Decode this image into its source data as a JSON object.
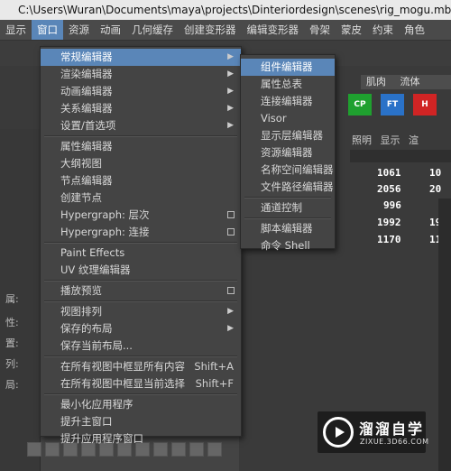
{
  "title": "C:\\Users\\Wuran\\Documents\\maya\\projects\\Dinteriordesign\\scenes\\rig_mogu.mb -",
  "menubar": [
    "显示",
    "窗口",
    "资源",
    "动画",
    "几何缓存",
    "创建变形器",
    "编辑变形器",
    "骨架",
    "蒙皮",
    "约束",
    "角色"
  ],
  "menubar_active": 1,
  "tabs_right": [
    "肌肉",
    "流体"
  ],
  "shelf_icons": [
    {
      "label": "CP",
      "color": "#1fa02f"
    },
    {
      "label": "FT",
      "color": "#2a72c8"
    },
    {
      "label": "H",
      "color": "#d02424"
    }
  ],
  "table_header": [
    "照明",
    "显示",
    "渲"
  ],
  "numbers": [
    "1061",
    "2056",
    "996",
    "1992",
    "1170"
  ],
  "numbers_right": [
    "10",
    "20",
    "",
    "19",
    "11"
  ],
  "left_fragments": [
    "属:",
    "性:",
    "置:",
    "列:",
    "局:"
  ],
  "window_menu": {
    "items": [
      {
        "label": "常规编辑器",
        "submenu": true,
        "highlight": true
      },
      {
        "label": "渲染编辑器",
        "submenu": true
      },
      {
        "label": "动画编辑器",
        "submenu": true
      },
      {
        "label": "关系编辑器",
        "submenu": true
      },
      {
        "label": "设置/首选项",
        "submenu": true
      },
      {
        "sep": true
      },
      {
        "label": "属性编辑器"
      },
      {
        "label": "大纲视图"
      },
      {
        "label": "节点编辑器"
      },
      {
        "label": "创建节点"
      },
      {
        "label": "Hypergraph: 层次",
        "option": true
      },
      {
        "label": "Hypergraph: 连接",
        "option": true
      },
      {
        "sep": true
      },
      {
        "label": "Paint Effects"
      },
      {
        "label": "UV 纹理编辑器"
      },
      {
        "sep": true
      },
      {
        "label": "播放预览",
        "option": true
      },
      {
        "sep": true
      },
      {
        "label": "视图排列",
        "submenu": true
      },
      {
        "label": "保存的布局",
        "submenu": true
      },
      {
        "label": "保存当前布局..."
      },
      {
        "sep": true
      },
      {
        "label": "在所有视图中框显所有内容",
        "shortcut": "Shift+A"
      },
      {
        "label": "在所有视图中框显当前选择",
        "shortcut": "Shift+F"
      },
      {
        "sep": true
      },
      {
        "label": "最小化应用程序"
      },
      {
        "label": "提升主窗口"
      },
      {
        "label": "提升应用程序窗口"
      }
    ]
  },
  "general_editors_submenu": {
    "items": [
      {
        "label": "组件编辑器",
        "highlight": true
      },
      {
        "label": "属性总表"
      },
      {
        "label": "连接编辑器"
      },
      {
        "label": "Visor"
      },
      {
        "label": "显示层编辑器"
      },
      {
        "label": "资源编辑器"
      },
      {
        "label": "名称空间编辑器"
      },
      {
        "label": "文件路径编辑器"
      },
      {
        "sep": true
      },
      {
        "label": "通道控制"
      },
      {
        "sep": true
      },
      {
        "label": "脚本编辑器"
      },
      {
        "label": "命令 Shell"
      }
    ]
  },
  "watermark": {
    "name": "溜溜自学",
    "url": "ZIXUE.3D66.COM"
  }
}
